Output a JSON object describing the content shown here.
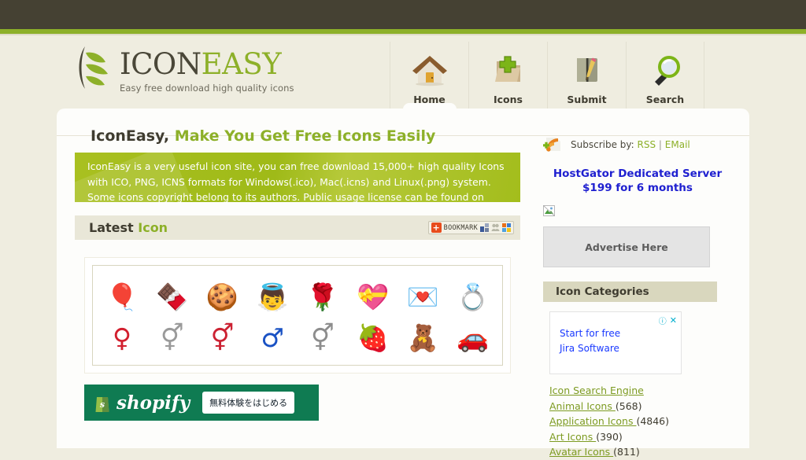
{
  "site": {
    "logo_title_part1": "ICON",
    "logo_title_part2": "EASY",
    "tagline": "Easy free download high quality icons"
  },
  "nav": {
    "items": [
      {
        "label": "Home",
        "icon": "house-icon",
        "active": true
      },
      {
        "label": "Icons",
        "icon": "folder-add-icon",
        "active": false
      },
      {
        "label": "Submit",
        "icon": "notebook-pencil-icon",
        "active": false
      },
      {
        "label": "Search",
        "icon": "magnifier-icon",
        "active": false
      }
    ]
  },
  "main": {
    "heading_dark": "IconEasy,",
    "heading_green": "Make You Get Free Icons Easily",
    "intro": "IconEasy is a very useful icon site, you can free download 15,000+ high quality Icons with ICO, PNG, ICNS formats for Windows(.ico), Mac(.icns) and Linux(.png) system. Some icons copyright belong to its authors. Public usage license can be found on each icon set page.",
    "section_title_dark": "Latest",
    "section_title_green": "Icon",
    "bookmark": {
      "plus": "+",
      "label": "BOOKMARK"
    },
    "icon_grid": {
      "row1": [
        {
          "name": "heart-balloons-icon",
          "glyph": "🎈"
        },
        {
          "name": "chocolate-box-icon",
          "glyph": "🍫"
        },
        {
          "name": "heart-cookies-icon",
          "glyph": "🍪"
        },
        {
          "name": "cupid-icon",
          "glyph": "👼"
        },
        {
          "name": "rose-heart-icon",
          "glyph": "🌹"
        },
        {
          "name": "valentine-heart-icon",
          "glyph": "💝"
        },
        {
          "name": "love-letter-icon",
          "glyph": "💌"
        },
        {
          "name": "wedding-rings-icon",
          "glyph": "💍"
        }
      ],
      "row2": [
        {
          "name": "female-symbol-icon",
          "glyph": "♀"
        },
        {
          "name": "gender-circle-icon",
          "glyph": "⚥"
        },
        {
          "name": "male-female-symbol-icon",
          "glyph": "⚥"
        },
        {
          "name": "male-symbol-icon",
          "glyph": "♂"
        },
        {
          "name": "gray-gender-symbol-icon",
          "glyph": "⚥"
        },
        {
          "name": "chocolate-strawberry-icon",
          "glyph": "🍓"
        },
        {
          "name": "teddy-bear-icon",
          "glyph": "🧸"
        },
        {
          "name": "wedding-car-icon",
          "glyph": "🚗"
        }
      ]
    },
    "shopify_ad": {
      "brand": "shopify",
      "cta": "無料体験をはじめる"
    }
  },
  "sidebar": {
    "subscribe_label": "Subscribe by:",
    "subscribe_rss": "RSS",
    "subscribe_sep": "|",
    "subscribe_email": "EMail",
    "hostgator_line1": "HostGator Dedicated Server",
    "hostgator_line2": "$199 for 6 months",
    "advertise_label": "Advertise Here",
    "categories_header": "Icon Categories",
    "adsense": {
      "line1": "Start for free",
      "line2": "Jira Software",
      "info_glyph": "ⓘ",
      "close_glyph": "✕"
    },
    "categories": [
      {
        "label": "Icon Search Engine",
        "count": ""
      },
      {
        "label": "Animal Icons ",
        "count": "(568)"
      },
      {
        "label": "Application Icons ",
        "count": "(4846)"
      },
      {
        "label": "Art Icons ",
        "count": "(390)"
      },
      {
        "label": "Avatar Icons ",
        "count": "(811)"
      }
    ]
  },
  "colors": {
    "topbar": "#454133",
    "accent_green": "#8db029",
    "page_bg": "#efede0",
    "panel_bg": "#fdfdfb",
    "link_green": "#7d9b22",
    "ad_blue": "#1f20d0"
  }
}
